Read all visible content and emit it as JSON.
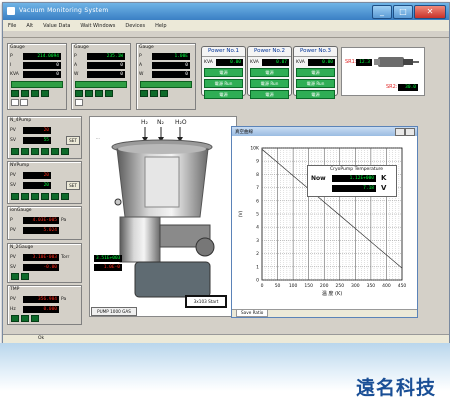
{
  "window": {
    "title": "Vacuum Monitoring System",
    "buttons": [
      "_",
      "□",
      "✕"
    ]
  },
  "menu": [
    "File",
    "Alt",
    "Value Data",
    "Wait Windows",
    "Devices",
    "Help"
  ],
  "panels_top": [
    {
      "title": "Gauge",
      "labels": [
        "P",
        "I",
        "KVA"
      ],
      "values": [
        "214.0094",
        "0",
        "0"
      ]
    },
    {
      "title": "Gauge",
      "labels": [
        "P",
        "A",
        "W"
      ],
      "values": [
        "235.1W",
        "0",
        "0"
      ]
    },
    {
      "title": "Gauge",
      "labels": [
        "P",
        "A",
        "W"
      ],
      "values": [
        "1.00E",
        "0",
        "0"
      ]
    }
  ],
  "panels_left": [
    {
      "title": "N_4Pump",
      "labels": [
        "PV",
        "SV"
      ],
      "values": [
        "20",
        "55"
      ],
      "btn": "SET"
    },
    {
      "title": "NVPump",
      "labels": [
        "PV",
        "SV"
      ],
      "values": [
        "20",
        "20"
      ],
      "btn": "SET"
    },
    {
      "title": "ionGauge",
      "labels": [
        "P",
        "PV"
      ],
      "values": [
        "4.03E-005",
        "5.024"
      ],
      "unit": "Pa"
    },
    {
      "title": "N_2Gauge",
      "labels": [
        "PV",
        "SV"
      ],
      "values": [
        "3.10E-003",
        "-0.00"
      ],
      "unit": "Torr"
    },
    {
      "title": "TMP",
      "labels": [
        "PV",
        "Hz"
      ],
      "values": [
        "356.984",
        "0.000"
      ],
      "unit": "Pa"
    }
  ],
  "power": [
    {
      "name": "Power No.1",
      "kva": "0.00",
      "b1": "電源",
      "b2": "電源 Run",
      "b3": "電源"
    },
    {
      "name": "Power No.2",
      "kva": "0.07",
      "b1": "電源",
      "b2": "電源 Run",
      "b3": "電源"
    },
    {
      "name": "Power No.3",
      "kva": "0.00",
      "b1": "電源",
      "b2": "電源 Run",
      "b3": "電源"
    }
  ],
  "sensor": {
    "sr1": "SR1:",
    "sr1_val": "12.3",
    "sr2": "SR2:",
    "sr2_val": "30.0"
  },
  "diagram": {
    "gases": [
      "H₂",
      "N₂",
      "H₂O"
    ],
    "readout_values": [
      "3.51E+003",
      "1.0E-0"
    ],
    "stop_label": "3x103 Start",
    "lower_label": "PUMP 1000 GAS"
  },
  "chart_window": {
    "title": "真空曲線",
    "tab": "Save Ratio",
    "readout": {
      "title": "CryoPump Temperature",
      "now_label": "Now",
      "value1": "1.12E+000",
      "unit1": "K",
      "value2": "7.18",
      "unit2": "V"
    }
  },
  "chart_data": {
    "type": "line",
    "title": "",
    "xlabel": "温  度  (K)",
    "ylabel": "(V)",
    "xlim": [
      0,
      450
    ],
    "ylim": [
      0,
      10
    ],
    "x_ticks": [
      0,
      50,
      100,
      150,
      200,
      250,
      300,
      350,
      400,
      450
    ],
    "y_ticks": [
      0,
      1,
      2,
      3,
      4,
      5,
      6,
      7,
      8,
      9,
      10
    ],
    "y_tick_labels": [
      "0",
      "1",
      "2",
      "3",
      "4",
      "5",
      "6",
      "7",
      "8",
      "9",
      "10K"
    ],
    "grid": true,
    "series": [
      {
        "x": [
          0,
          50,
          100,
          150,
          200,
          250,
          300,
          350,
          400,
          450
        ],
        "y": [
          9.9,
          8.9,
          7.9,
          6.9,
          5.9,
          4.9,
          3.9,
          2.9,
          1.9,
          0.9
        ]
      }
    ]
  },
  "status": {
    "text": "Ok"
  },
  "company": "遠名科技",
  "colors": {
    "lcd_bg": "#000000",
    "lcd_green": "#00ff3c",
    "lcd_red": "#ff2a1a",
    "button_green": "#2fae55",
    "title_blue": "#3a7fc4"
  }
}
